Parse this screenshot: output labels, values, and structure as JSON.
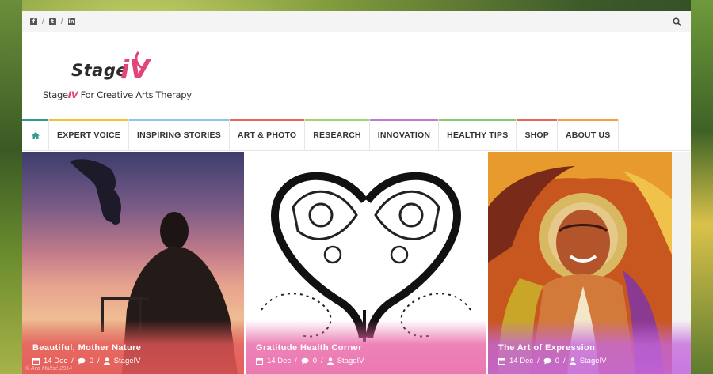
{
  "social": {
    "icons": [
      "facebook-icon",
      "twitter-icon",
      "linkedin-icon"
    ],
    "separator": "/"
  },
  "logo": {
    "word": "Stage",
    "iv": "iV",
    "tagline_start": "Stage",
    "tagline_iv": "IV",
    "tagline_end": " For Creative Arts Therapy"
  },
  "nav": {
    "home_icon": "home-icon",
    "items": [
      {
        "label": "EXPERT VOICE",
        "color": "#f2c037"
      },
      {
        "label": "INSPIRING STORIES",
        "color": "#8ac6e8"
      },
      {
        "label": "ART & PHOTO",
        "color": "#e9645e"
      },
      {
        "label": "RESEARCH",
        "color": "#a3d16a"
      },
      {
        "label": "INNOVATION",
        "color": "#c07ad4"
      },
      {
        "label": "HEALTHY TIPS",
        "color": "#88c870"
      },
      {
        "label": "SHOP",
        "color": "#e9645e"
      },
      {
        "label": "ABOUT US",
        "color": "#f0a040"
      }
    ]
  },
  "colors": {
    "home_accent": "#2f9c8f",
    "brand_pink": "#e0457b"
  },
  "cards": [
    {
      "title": "Beautiful, Mother Nature",
      "date": "14 Dec",
      "comments": "0",
      "author": "StageIV",
      "watermark": "© Ava Maltsé 2014"
    },
    {
      "title": "Gratitude Health Corner",
      "date": "14 Dec",
      "comments": "0",
      "author": "StageIV"
    },
    {
      "title": "The Art of Expression",
      "date": "14 Dec",
      "comments": "0",
      "author": "StageIV"
    }
  ]
}
